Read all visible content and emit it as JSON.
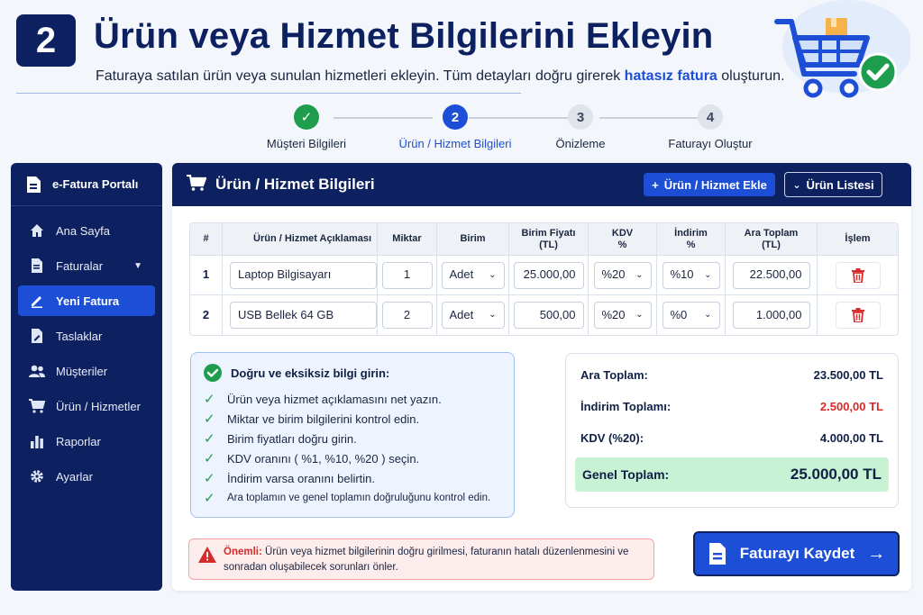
{
  "header": {
    "step_number": "2",
    "title": "Ürün veya Hizmet Bilgilerini Ekleyin",
    "subtitle_before": "Faturaya satılan ürün veya sunulan hizmetleri ekleyin. Tüm detayları doğru girerek ",
    "subtitle_highlight": "hatasız fatura",
    "subtitle_after": " oluşturun."
  },
  "stepper": [
    {
      "number": "✓",
      "label": "Müşteri Bilgileri",
      "state": "done"
    },
    {
      "number": "2",
      "label": "Ürün / Hizmet Bilgileri",
      "state": "active"
    },
    {
      "number": "3",
      "label": "Önizleme",
      "state": "todo"
    },
    {
      "number": "4",
      "label": "Faturayı Oluştur",
      "state": "todo"
    }
  ],
  "sidebar": {
    "title": "e-Fatura Portalı",
    "items": [
      {
        "label": "Ana Sayfa",
        "icon": "home-icon"
      },
      {
        "label": "Faturalar",
        "icon": "document-icon"
      },
      {
        "label": "Yeni Fatura",
        "icon": "edit-icon"
      },
      {
        "label": "Taslaklar",
        "icon": "draft-icon"
      },
      {
        "label": "Müşteriler",
        "icon": "users-icon"
      },
      {
        "label": "Ürün / Hizmetler",
        "icon": "cart-icon"
      },
      {
        "label": "Raporlar",
        "icon": "chart-icon"
      },
      {
        "label": "Ayarlar",
        "icon": "gear-icon"
      }
    ]
  },
  "main": {
    "title": "Ürün / Hizmet Bilgileri",
    "add_button": "Ürün / Hizmet Ekle",
    "list_button": "Ürün Listesi"
  },
  "table": {
    "headers": [
      "#",
      "Ürün / Hizmet Açıklaması",
      "Miktar",
      "Birim",
      "Birim Fiyatı\n(TL)",
      "KDV\n%",
      "İndirim\n%",
      "Ara Toplam\n(TL)",
      "İşlem"
    ],
    "rows": [
      {
        "no": "1",
        "desc": "Laptop Bilgisayarı",
        "qty": "1",
        "unit": "Adet",
        "price": "25.000,00",
        "vat": "%20",
        "discount": "%10",
        "subtotal": "22.500,00"
      },
      {
        "no": "2",
        "desc": "USB Bellek 64 GB",
        "qty": "2",
        "unit": "Adet",
        "price": "500,00",
        "vat": "%20",
        "discount": "%0",
        "subtotal": "1.000,00"
      }
    ]
  },
  "tips": {
    "title": "Doğru ve eksiksiz bilgi girin:",
    "items": [
      "Ürün veya hizmet açıklamasını net yazın.",
      "Miktar ve birim bilgilerini kontrol edin.",
      "Birim fiyatları doğru girin.",
      "KDV oranını ( %1, %10, %20 ) seçin.",
      "İndirim varsa oranını belirtin.",
      "Ara toplamın ve genel toplamın doğruluğunu kontrol edin."
    ]
  },
  "totals": {
    "subtotal_label": "Ara Toplam:",
    "subtotal_value": "23.500,00 TL",
    "discount_label": "İndirim Toplamı:",
    "discount_value": "2.500,00 TL",
    "vat_label": "KDV (%20):",
    "vat_value": "4.000,00 TL",
    "grand_label": "Genel Toplam:",
    "grand_value": "25.000,00 TL"
  },
  "warning": {
    "label": "Önemli:",
    "text": " Ürün veya hizmet bilgilerinin doğru girilmesi, faturanın hatalı düzenlenmesini ve sonradan oluşabilecek sorunları önler."
  },
  "save_button": "Faturayı Kaydet",
  "colors": {
    "navy": "#0d2161",
    "accent": "#1c4fd6",
    "success": "#1f9d4f",
    "danger": "#d62b2b"
  }
}
